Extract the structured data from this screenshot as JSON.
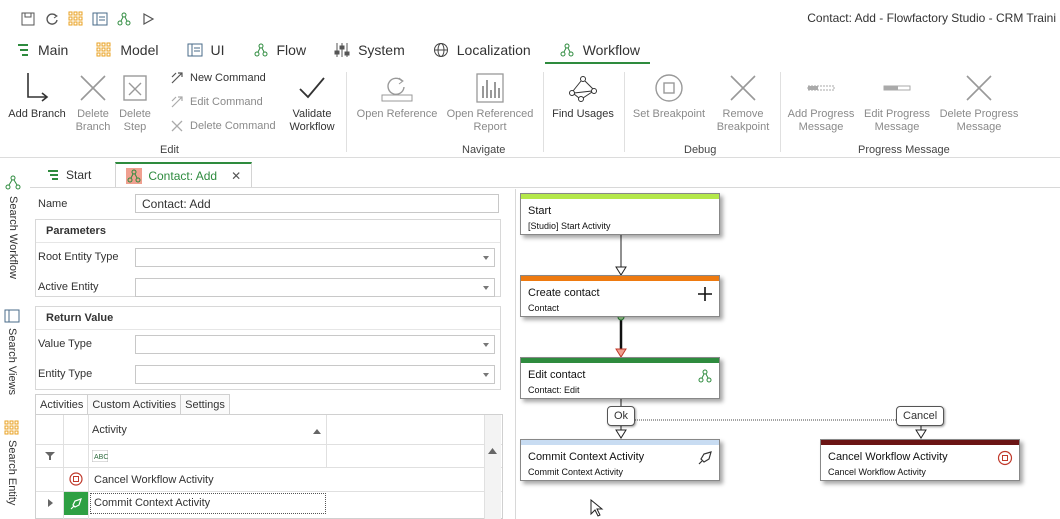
{
  "window": {
    "title": "Contact: Add  - Flowfactory Studio - CRM Traini"
  },
  "menu_tabs": [
    {
      "label": "Main",
      "icon": "flow-icon"
    },
    {
      "label": "Model",
      "icon": "grid-icon"
    },
    {
      "label": "UI",
      "icon": "ui-icon"
    },
    {
      "label": "Flow",
      "icon": "flow-icon"
    },
    {
      "label": "System",
      "icon": "sliders-icon"
    },
    {
      "label": "Localization",
      "icon": "globe-icon"
    },
    {
      "label": "Workflow",
      "icon": "workflow-icon",
      "active": true
    }
  ],
  "ribbon": {
    "edit": {
      "group": "Edit",
      "add_branch": "Add Branch",
      "delete_branch": "Delete Branch",
      "delete_step": "Delete Step",
      "new_command": "New Command",
      "edit_command": "Edit Command",
      "delete_command": "Delete Command",
      "validate_workflow": "Validate Workflow"
    },
    "navigate": {
      "group": "Navigate",
      "open_reference": "Open Reference",
      "open_referenced_report": "Open Referenced Report",
      "find_usages": "Find Usages"
    },
    "debug": {
      "group": "Debug",
      "set_breakpoint": "Set Breakpoint",
      "remove_breakpoint": "Remove Breakpoint"
    },
    "progress": {
      "group": "Progress Message",
      "add": "Add Progress Message",
      "edit": "Edit Progress Message",
      "delete": "Delete Progress Message"
    }
  },
  "side_nav": [
    {
      "label": "Search Workflow"
    },
    {
      "label": "Search Views"
    },
    {
      "label": "Search Entity"
    }
  ],
  "doc_tabs": [
    {
      "label": "Start"
    },
    {
      "label": "Contact: Add",
      "active": true
    }
  ],
  "props": {
    "name_label": "Name",
    "name_value": "Contact: Add",
    "parameters_header": "Parameters",
    "root_entity_type_label": "Root Entity Type",
    "active_entity_label": "Active Entity",
    "return_value_header": "Return Value",
    "value_type_label": "Value Type",
    "entity_type_label": "Entity Type"
  },
  "activities": {
    "tabs": [
      "Activities",
      "Custom Activities",
      "Settings"
    ],
    "column_header": "Activity",
    "rows": [
      "Cancel Workflow Activity",
      "Commit Context Activity"
    ]
  },
  "workflow": {
    "nodes": [
      {
        "title": "Start",
        "subtitle": "[Studio] Start Activity",
        "color": "#b4e84a"
      },
      {
        "title": "Create contact",
        "subtitle": "Contact",
        "color": "#ee7a10"
      },
      {
        "title": "Edit contact",
        "subtitle": "Contact: Edit",
        "color": "#2e8b3e"
      },
      {
        "title": "Commit Context Activity",
        "subtitle": "Commit Context Activity",
        "color": "#c8dcf2"
      },
      {
        "title": "Cancel Workflow Activity",
        "subtitle": "Cancel Workflow Activity",
        "color": "#6b1414"
      }
    ],
    "edges": {
      "ok": "Ok",
      "cancel": "Cancel"
    }
  },
  "colors": {
    "accent": "#2e8b3e",
    "danger": "#c0392b"
  }
}
